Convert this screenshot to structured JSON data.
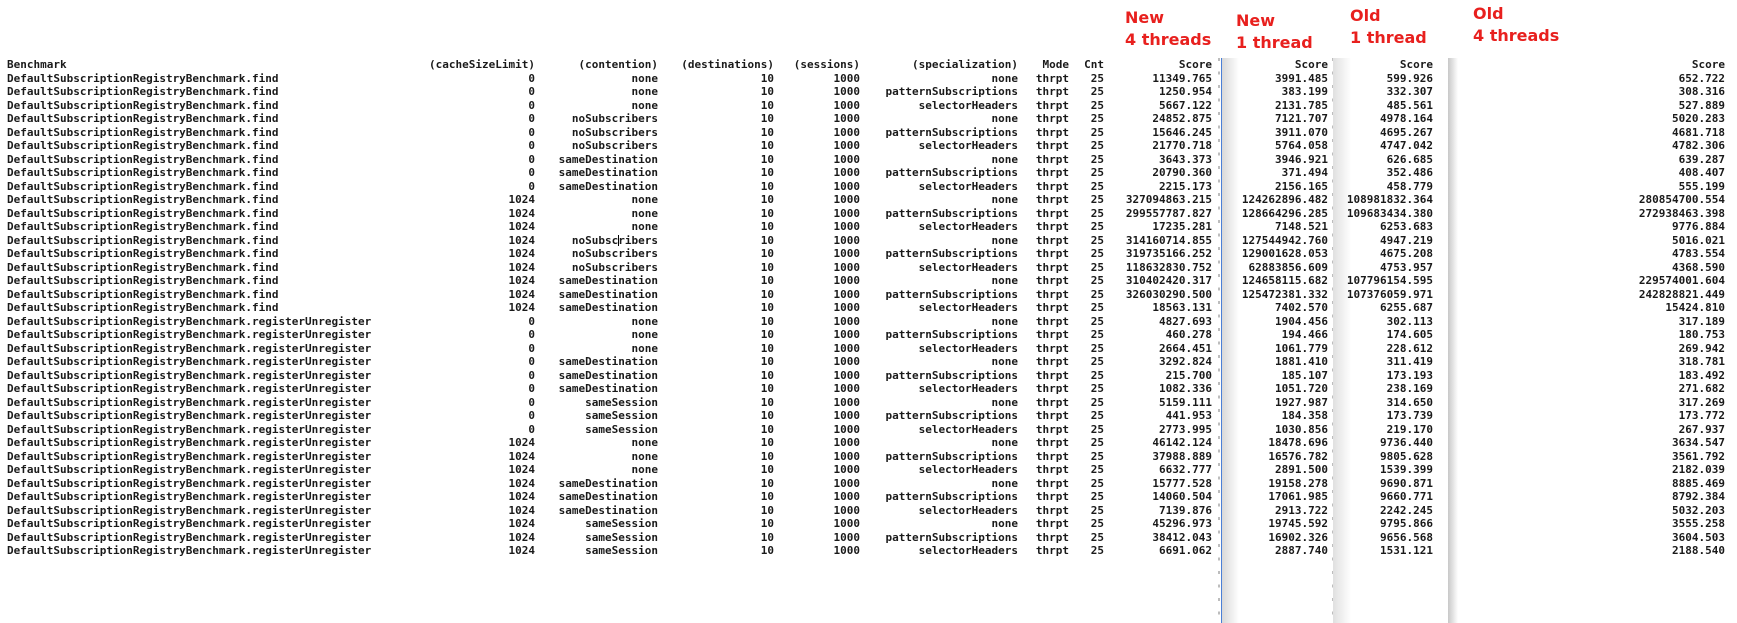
{
  "annotations": [
    {
      "line1": "New",
      "line2": "4 threads"
    },
    {
      "line1": "New",
      "line2": "1 thread"
    },
    {
      "line1": "Old",
      "line2": "1 thread"
    },
    {
      "line1": "Old",
      "line2": "4 threads"
    }
  ],
  "annotation_color": "#e8201e",
  "headers": {
    "benchmark": "Benchmark",
    "cacheSizeLimit": "(cacheSizeLimit)",
    "contention": "(contention)",
    "destinations": "(destinations)",
    "sessions": "(sessions)",
    "specialization": "(specialization)",
    "mode": "Mode",
    "cnt": "Cnt",
    "score_new_4": "Score",
    "score_new_1": "Score",
    "score_old_1": "Score",
    "score_old_4": "Score"
  },
  "rows": [
    [
      "DefaultSubscriptionRegistryBenchmark.find",
      "0",
      "none",
      "10",
      "1000",
      "none",
      "thrpt",
      "25",
      "11349.765",
      "3991.485",
      "599.926",
      "652.722"
    ],
    [
      "DefaultSubscriptionRegistryBenchmark.find",
      "0",
      "none",
      "10",
      "1000",
      "patternSubscriptions",
      "thrpt",
      "25",
      "1250.954",
      "383.199",
      "332.307",
      "308.316"
    ],
    [
      "DefaultSubscriptionRegistryBenchmark.find",
      "0",
      "none",
      "10",
      "1000",
      "selectorHeaders",
      "thrpt",
      "25",
      "5667.122",
      "2131.785",
      "485.561",
      "527.889"
    ],
    [
      "DefaultSubscriptionRegistryBenchmark.find",
      "0",
      "noSubscribers",
      "10",
      "1000",
      "none",
      "thrpt",
      "25",
      "24852.875",
      "7121.707",
      "4978.164",
      "5020.283"
    ],
    [
      "DefaultSubscriptionRegistryBenchmark.find",
      "0",
      "noSubscribers",
      "10",
      "1000",
      "patternSubscriptions",
      "thrpt",
      "25",
      "15646.245",
      "3911.070",
      "4695.267",
      "4681.718"
    ],
    [
      "DefaultSubscriptionRegistryBenchmark.find",
      "0",
      "noSubscribers",
      "10",
      "1000",
      "selectorHeaders",
      "thrpt",
      "25",
      "21770.718",
      "5764.058",
      "4747.042",
      "4782.306"
    ],
    [
      "DefaultSubscriptionRegistryBenchmark.find",
      "0",
      "sameDestination",
      "10",
      "1000",
      "none",
      "thrpt",
      "25",
      "3643.373",
      "3946.921",
      "626.685",
      "639.287"
    ],
    [
      "DefaultSubscriptionRegistryBenchmark.find",
      "0",
      "sameDestination",
      "10",
      "1000",
      "patternSubscriptions",
      "thrpt",
      "25",
      "20790.360",
      "371.494",
      "352.486",
      "408.407"
    ],
    [
      "DefaultSubscriptionRegistryBenchmark.find",
      "0",
      "sameDestination",
      "10",
      "1000",
      "selectorHeaders",
      "thrpt",
      "25",
      "2215.173",
      "2156.165",
      "458.779",
      "555.199"
    ],
    [
      "DefaultSubscriptionRegistryBenchmark.find",
      "1024",
      "none",
      "10",
      "1000",
      "none",
      "thrpt",
      "25",
      "327094863.215",
      "124262896.482",
      "108981832.364",
      "280854700.554"
    ],
    [
      "DefaultSubscriptionRegistryBenchmark.find",
      "1024",
      "none",
      "10",
      "1000",
      "patternSubscriptions",
      "thrpt",
      "25",
      "299557787.827",
      "128664296.285",
      "109683434.380",
      "272938463.398"
    ],
    [
      "DefaultSubscriptionRegistryBenchmark.find",
      "1024",
      "none",
      "10",
      "1000",
      "selectorHeaders",
      "thrpt",
      "25",
      "17235.281",
      "7148.521",
      "6253.683",
      "9776.884"
    ],
    [
      "DefaultSubscriptionRegistryBenchmark.find",
      "1024",
      "noSubscribers",
      "10",
      "1000",
      "none",
      "thrpt",
      "25",
      "314160714.855",
      "127544942.760",
      "4947.219",
      "5016.021"
    ],
    [
      "DefaultSubscriptionRegistryBenchmark.find",
      "1024",
      "noSubscribers",
      "10",
      "1000",
      "patternSubscriptions",
      "thrpt",
      "25",
      "319735166.252",
      "129001628.053",
      "4675.208",
      "4783.554"
    ],
    [
      "DefaultSubscriptionRegistryBenchmark.find",
      "1024",
      "noSubscribers",
      "10",
      "1000",
      "selectorHeaders",
      "thrpt",
      "25",
      "118632830.752",
      "62883856.609",
      "4753.957",
      "4368.590"
    ],
    [
      "DefaultSubscriptionRegistryBenchmark.find",
      "1024",
      "sameDestination",
      "10",
      "1000",
      "none",
      "thrpt",
      "25",
      "310402420.317",
      "124658115.682",
      "107796154.595",
      "229574001.604"
    ],
    [
      "DefaultSubscriptionRegistryBenchmark.find",
      "1024",
      "sameDestination",
      "10",
      "1000",
      "patternSubscriptions",
      "thrpt",
      "25",
      "326030290.500",
      "125472381.332",
      "107376059.971",
      "242828821.449"
    ],
    [
      "DefaultSubscriptionRegistryBenchmark.find",
      "1024",
      "sameDestination",
      "10",
      "1000",
      "selectorHeaders",
      "thrpt",
      "25",
      "18563.131",
      "7402.570",
      "6255.687",
      "15424.810"
    ],
    [
      "DefaultSubscriptionRegistryBenchmark.registerUnregister",
      "0",
      "none",
      "10",
      "1000",
      "none",
      "thrpt",
      "25",
      "4827.693",
      "1904.456",
      "302.113",
      "317.189"
    ],
    [
      "DefaultSubscriptionRegistryBenchmark.registerUnregister",
      "0",
      "none",
      "10",
      "1000",
      "patternSubscriptions",
      "thrpt",
      "25",
      "460.278",
      "194.466",
      "174.605",
      "180.753"
    ],
    [
      "DefaultSubscriptionRegistryBenchmark.registerUnregister",
      "0",
      "none",
      "10",
      "1000",
      "selectorHeaders",
      "thrpt",
      "25",
      "2664.451",
      "1061.779",
      "228.612",
      "269.942"
    ],
    [
      "DefaultSubscriptionRegistryBenchmark.registerUnregister",
      "0",
      "sameDestination",
      "10",
      "1000",
      "none",
      "thrpt",
      "25",
      "3292.824",
      "1881.410",
      "311.419",
      "318.781"
    ],
    [
      "DefaultSubscriptionRegistryBenchmark.registerUnregister",
      "0",
      "sameDestination",
      "10",
      "1000",
      "patternSubscriptions",
      "thrpt",
      "25",
      "215.700",
      "185.107",
      "173.193",
      "183.492"
    ],
    [
      "DefaultSubscriptionRegistryBenchmark.registerUnregister",
      "0",
      "sameDestination",
      "10",
      "1000",
      "selectorHeaders",
      "thrpt",
      "25",
      "1082.336",
      "1051.720",
      "238.169",
      "271.682"
    ],
    [
      "DefaultSubscriptionRegistryBenchmark.registerUnregister",
      "0",
      "sameSession",
      "10",
      "1000",
      "none",
      "thrpt",
      "25",
      "5159.111",
      "1927.987",
      "314.650",
      "317.269"
    ],
    [
      "DefaultSubscriptionRegistryBenchmark.registerUnregister",
      "0",
      "sameSession",
      "10",
      "1000",
      "patternSubscriptions",
      "thrpt",
      "25",
      "441.953",
      "184.358",
      "173.739",
      "173.772"
    ],
    [
      "DefaultSubscriptionRegistryBenchmark.registerUnregister",
      "0",
      "sameSession",
      "10",
      "1000",
      "selectorHeaders",
      "thrpt",
      "25",
      "2773.995",
      "1030.856",
      "219.170",
      "267.937"
    ],
    [
      "DefaultSubscriptionRegistryBenchmark.registerUnregister",
      "1024",
      "none",
      "10",
      "1000",
      "none",
      "thrpt",
      "25",
      "46142.124",
      "18478.696",
      "9736.440",
      "3634.547"
    ],
    [
      "DefaultSubscriptionRegistryBenchmark.registerUnregister",
      "1024",
      "none",
      "10",
      "1000",
      "patternSubscriptions",
      "thrpt",
      "25",
      "37988.889",
      "16576.782",
      "9805.628",
      "3561.792"
    ],
    [
      "DefaultSubscriptionRegistryBenchmark.registerUnregister",
      "1024",
      "none",
      "10",
      "1000",
      "selectorHeaders",
      "thrpt",
      "25",
      "6632.777",
      "2891.500",
      "1539.399",
      "2182.039"
    ],
    [
      "DefaultSubscriptionRegistryBenchmark.registerUnregister",
      "1024",
      "sameDestination",
      "10",
      "1000",
      "none",
      "thrpt",
      "25",
      "15777.528",
      "19158.278",
      "9690.871",
      "8885.469"
    ],
    [
      "DefaultSubscriptionRegistryBenchmark.registerUnregister",
      "1024",
      "sameDestination",
      "10",
      "1000",
      "patternSubscriptions",
      "thrpt",
      "25",
      "14060.504",
      "17061.985",
      "9660.771",
      "8792.384"
    ],
    [
      "DefaultSubscriptionRegistryBenchmark.registerUnregister",
      "1024",
      "sameDestination",
      "10",
      "1000",
      "selectorHeaders",
      "thrpt",
      "25",
      "7139.876",
      "2913.722",
      "2242.245",
      "5032.203"
    ],
    [
      "DefaultSubscriptionRegistryBenchmark.registerUnregister",
      "1024",
      "sameSession",
      "10",
      "1000",
      "none",
      "thrpt",
      "25",
      "45296.973",
      "19745.592",
      "9795.866",
      "3555.258"
    ],
    [
      "DefaultSubscriptionRegistryBenchmark.registerUnregister",
      "1024",
      "sameSession",
      "10",
      "1000",
      "patternSubscriptions",
      "thrpt",
      "25",
      "38412.043",
      "16902.326",
      "9656.568",
      "3604.503"
    ],
    [
      "DefaultSubscriptionRegistryBenchmark.registerUnregister",
      "1024",
      "sameSession",
      "10",
      "1000",
      "selectorHeaders",
      "thrpt",
      "25",
      "6691.062",
      "2887.740",
      "1531.121",
      "2188.540"
    ]
  ],
  "cursor_row": 12
}
